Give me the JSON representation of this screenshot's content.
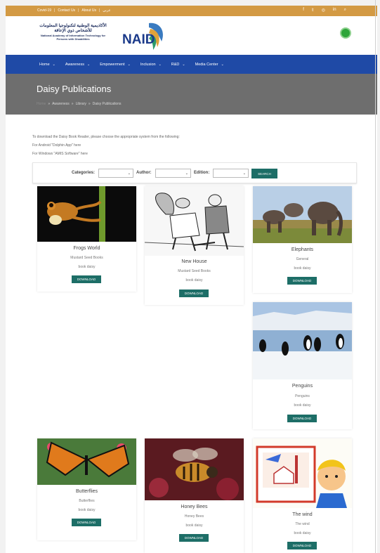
{
  "topbar": {
    "links": [
      "Covid-19",
      "Contact Us",
      "About Us",
      "عربي"
    ],
    "separator": "|",
    "social_icons": [
      "facebook-icon",
      "twitter-icon",
      "instagram-icon",
      "linkedin-icon",
      "search-icon"
    ],
    "social_glyphs": [
      "f",
      "𝕥",
      "◎",
      "in",
      "⌕"
    ],
    "color": "#d39a44"
  },
  "header": {
    "logo_arabic": "الأكاديمية الوطنية لتكنولوجيا المعلومات للأشخاص ذوي الإعاقة",
    "logo_english": "National Academy of Information Technology for Persons with Disabilities",
    "logo_mark": "NAID"
  },
  "nav": {
    "items": [
      "Home",
      "Awareness",
      "Empowerment",
      "Inclusion",
      "R&D",
      "Media Center"
    ],
    "chevron": "⌄",
    "color": "#1f4aa6"
  },
  "hero": {
    "title": "Daisy Publications",
    "breadcrumbs": [
      "Home",
      "»",
      "Awareness",
      "»",
      "Library",
      "»",
      "Daisy Publications"
    ]
  },
  "intro": {
    "line1": "To download the Daisy Book Reader, please choose the appropriate system from the following:",
    "line2": "For Android \"Dolphin App\" here",
    "line3": "For Windows \"AMIS Software\" here"
  },
  "filter": {
    "categories_label": "Categories:",
    "author_label": "Author:",
    "edition_label": "Edition:",
    "search_label": "SEARCH",
    "arrow": "⌄"
  },
  "books": [
    {
      "title": "Frogs World",
      "author": "Mustard Seed Books",
      "type": "book daisy",
      "download": "DOWNLOAD"
    },
    {
      "title": "New House",
      "author": "Mustard Seed Books",
      "type": "book daisy",
      "download": "DOWNLOAD"
    },
    {
      "title": "Elephants",
      "author": "General",
      "type": "book daisy",
      "download": "DOWNLOAD"
    },
    {
      "title": "Penguins",
      "author": "Penguins",
      "type": "book daisy",
      "download": "DOWNLOAD"
    },
    {
      "title": "Butterflies",
      "author": "Butterflies",
      "type": "book daisy",
      "download": "DOWNLOAD"
    },
    {
      "title": "Honey Bees",
      "author": "Honey Bees",
      "type": "book daisy",
      "download": "DOWNLOAD"
    },
    {
      "title": "The wind",
      "author": "The wind",
      "type": "book daisy",
      "download": "DOWNLOAD"
    }
  ],
  "colors": {
    "accent": "#1d6e67",
    "hero": "#6e6e6e"
  }
}
